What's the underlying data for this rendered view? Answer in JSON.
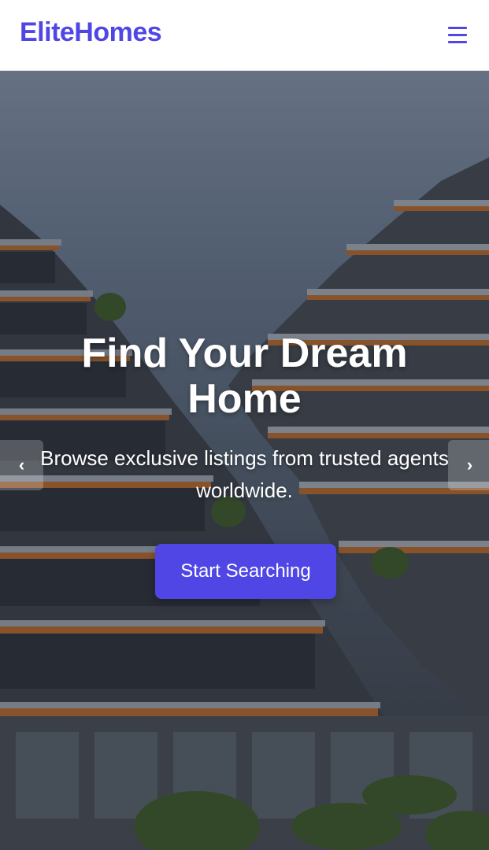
{
  "header": {
    "logo": "EliteHomes",
    "menu_icon": "hamburger-menu-icon"
  },
  "hero": {
    "title": "Find Your Dream Home",
    "subtitle": "Browse exclusive listings from trusted agents worldwide.",
    "cta_label": "Start Searching",
    "prev_glyph": "‹",
    "next_glyph": "›"
  },
  "colors": {
    "brand": "#4f46e5",
    "background": "#ffffff",
    "hero_text": "#ffffff"
  }
}
